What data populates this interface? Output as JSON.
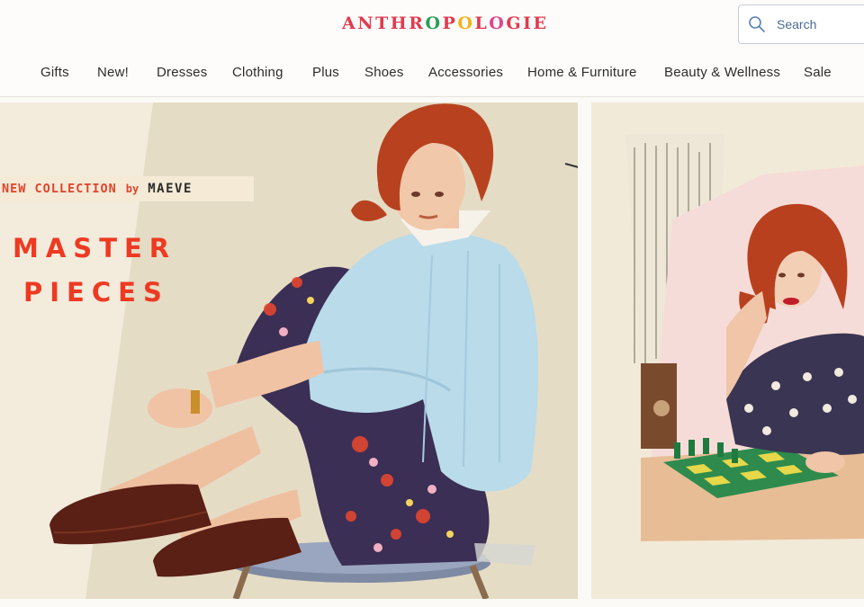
{
  "brand": {
    "logo_letters": [
      {
        "ch": "A",
        "color": "#e23a4f"
      },
      {
        "ch": "N",
        "color": "#e23a4f"
      },
      {
        "ch": "T",
        "color": "#e23a4f"
      },
      {
        "ch": "H",
        "color": "#e23a4f"
      },
      {
        "ch": "R",
        "color": "#e23a4f"
      },
      {
        "ch": "O",
        "color": "#2a9d5a"
      },
      {
        "ch": "P",
        "color": "#e23a4f"
      },
      {
        "ch": "O",
        "color": "#f2b41c"
      },
      {
        "ch": "L",
        "color": "#e23a4f"
      },
      {
        "ch": "O",
        "color": "#e0448f"
      },
      {
        "ch": "G",
        "color": "#e23a4f"
      },
      {
        "ch": "I",
        "color": "#e23a4f"
      },
      {
        "ch": "E",
        "color": "#e23a4f"
      }
    ]
  },
  "search": {
    "placeholder": "Search",
    "icon": "search-icon",
    "icon_color": "#5a7fb8"
  },
  "nav": {
    "items": [
      {
        "label": "Gifts"
      },
      {
        "label": "New!"
      },
      {
        "label": "Dresses"
      },
      {
        "label": "Clothing"
      },
      {
        "label": "Plus"
      },
      {
        "label": "Shoes"
      },
      {
        "label": "Accessories"
      },
      {
        "label": "Home & Furniture"
      },
      {
        "label": "Beauty & Wellness"
      },
      {
        "label": "Sale"
      }
    ]
  },
  "hero": {
    "badge": {
      "collection": "NEW COLLECTION",
      "by": "by",
      "brand": "MAEVE"
    },
    "headline_lines": [
      "MASTER",
      "PIECES"
    ],
    "accent_color": "#ee3a22"
  }
}
